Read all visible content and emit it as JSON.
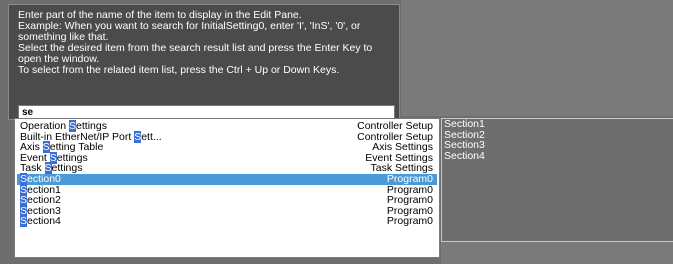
{
  "help": {
    "text": "Enter part of the name of the item to display in the Edit Pane.\nExample: When you want to search for InitialSetting0, enter 'I', 'InS', '0', or\nsomething like that.\nSelect the desired item from the search result list and press the Enter Key to\nopen the window.\nTo select from the related item list, press the Ctrl + Up or Down Keys."
  },
  "search": {
    "value": "se"
  },
  "results": [
    {
      "pre": "Operation ",
      "hl": "S",
      "post": "ettings",
      "category": "Controller Setup",
      "selected": false
    },
    {
      "pre": "Built-in EtherNet/IP Port ",
      "hl": "S",
      "post": "ett...",
      "category": "Controller Setup",
      "selected": false
    },
    {
      "pre": "Axis ",
      "hl": "S",
      "post": "etting Table",
      "category": "Axis Settings",
      "selected": false
    },
    {
      "pre": "Event ",
      "hl": "S",
      "post": "ettings",
      "category": "Event Settings",
      "selected": false
    },
    {
      "pre": "Task ",
      "hl": "S",
      "post": "ettings",
      "category": "Task Settings",
      "selected": false
    },
    {
      "pre": "",
      "hl": "S",
      "post": "ection0",
      "category": "Program0",
      "selected": true
    },
    {
      "pre": "",
      "hl": "S",
      "post": "ection1",
      "category": "Program0",
      "selected": false
    },
    {
      "pre": "",
      "hl": "S",
      "post": "ection2",
      "category": "Program0",
      "selected": false
    },
    {
      "pre": "",
      "hl": "S",
      "post": "ection3",
      "category": "Program0",
      "selected": false
    },
    {
      "pre": "",
      "hl": "S",
      "post": "ection4",
      "category": "Program0",
      "selected": false
    }
  ],
  "related": [
    "Section1",
    "Section2",
    "Section3",
    "Section4"
  ],
  "colors": {
    "selected_row": "#4a9ad8",
    "match_highlight": "#3b6fd6"
  }
}
